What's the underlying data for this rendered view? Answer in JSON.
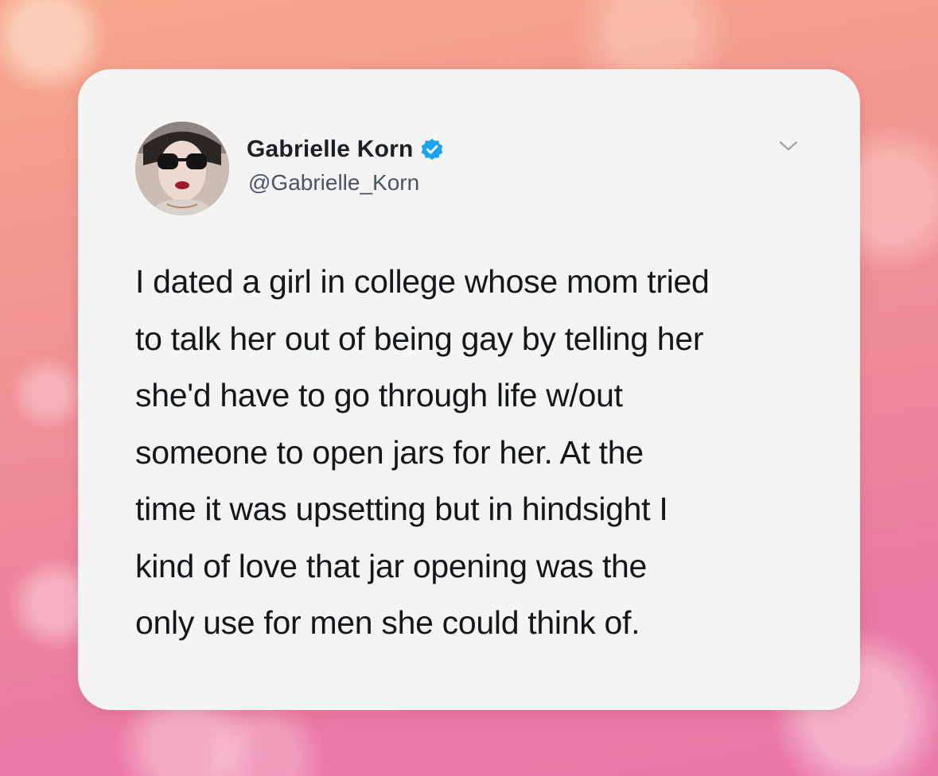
{
  "tweet": {
    "author": {
      "display_name": "Gabrielle Korn",
      "handle": "@Gabrielle_Korn",
      "verified": true
    },
    "text": "I dated a girl in college whose mom tried\nto talk her out of being gay by telling her\nshe'd have to go through life w/out\nsomeone to open jars for her. At the\ntime it was upsetting but in hindsight I\nkind of love that jar opening was the\nonly use for men she could think of."
  },
  "icons": {
    "verified": "verified-badge-icon",
    "more": "chevron-down-icon"
  },
  "colors": {
    "verified_blue": "#1da1f2",
    "text_primary": "#14171a",
    "text_secondary": "#4a5560",
    "card_background": "#f4f4f5"
  }
}
